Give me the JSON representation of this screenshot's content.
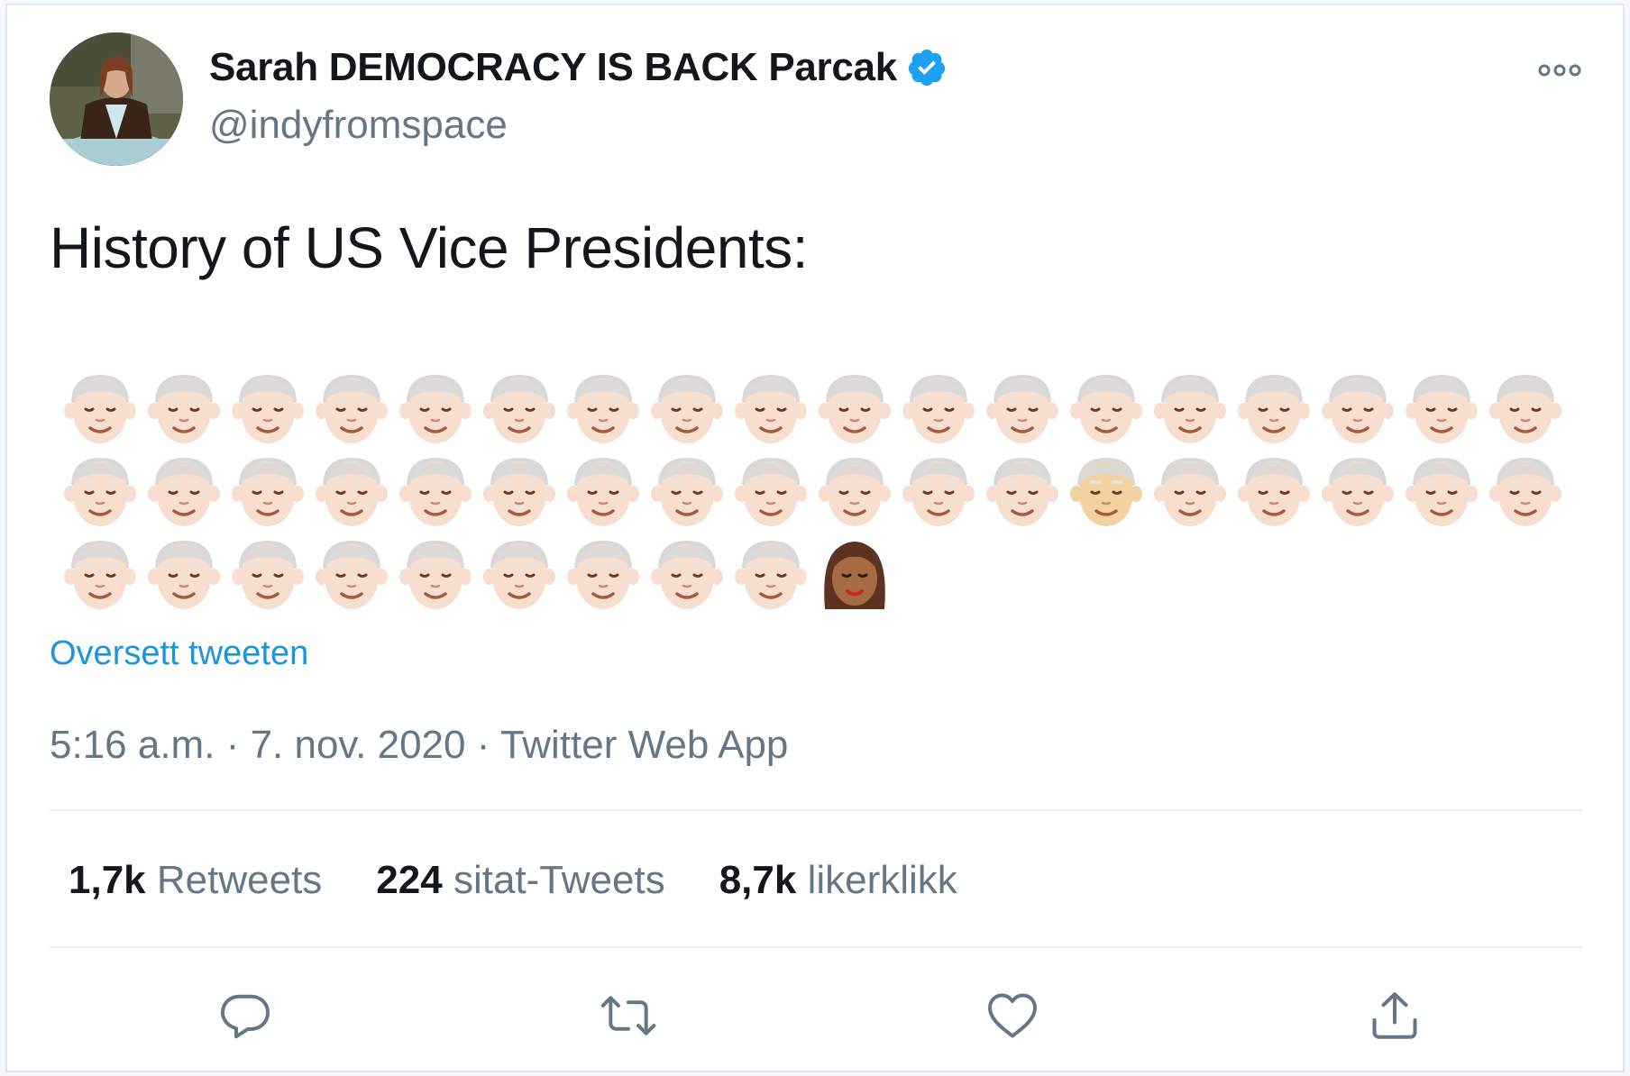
{
  "tweet": {
    "author": {
      "display_name": "Sarah DEMOCRACY IS BACK Parcak",
      "handle": "@indyfromspace",
      "verified": true
    },
    "text": "History of US Vice Presidents:",
    "emoji_rows": [
      [
        "older-man-light",
        "older-man-light",
        "older-man-light",
        "older-man-light",
        "older-man-light",
        "older-man-light",
        "older-man-light",
        "older-man-light",
        "older-man-light",
        "older-man-light",
        "older-man-light",
        "older-man-light",
        "older-man-light",
        "older-man-light",
        "older-man-light",
        "older-man-light",
        "older-man-light",
        "older-man-light"
      ],
      [
        "older-man-light",
        "older-man-light",
        "older-man-light",
        "older-man-light",
        "older-man-light",
        "older-man-light",
        "older-man-light",
        "older-man-light",
        "older-man-light",
        "older-man-light",
        "older-man-light",
        "older-man-light",
        "older-man-default",
        "older-man-light",
        "older-man-light",
        "older-man-light",
        "older-man-light",
        "older-man-light"
      ],
      [
        "older-man-light",
        "older-man-light",
        "older-man-light",
        "older-man-light",
        "older-man-light",
        "older-man-light",
        "older-man-light",
        "older-man-light",
        "older-man-light",
        "woman-medium-dark"
      ]
    ],
    "translate_label": "Oversett tweeten",
    "time": "5:16 a.m.",
    "date": "7. nov. 2020",
    "source": "Twitter Web App",
    "separator": "·",
    "stats": {
      "retweets": {
        "count": "1,7k",
        "label": "Retweets"
      },
      "quotes": {
        "count": "224",
        "label": "sitat-Tweets"
      },
      "likes": {
        "count": "8,7k",
        "label": "likerklikk"
      }
    }
  },
  "colors": {
    "text_primary": "#14171a",
    "text_secondary": "#657786",
    "link": "#1b95e0",
    "verified": "#1da1f2",
    "divider": "#e6ecf0",
    "skin_light": "#f7dece",
    "skin_default": "#f3d2a2",
    "hair_gray": "#d9d9d9"
  },
  "icons": [
    "more-icon",
    "verified-badge-icon",
    "reply-icon",
    "retweet-icon",
    "like-icon",
    "share-icon"
  ]
}
